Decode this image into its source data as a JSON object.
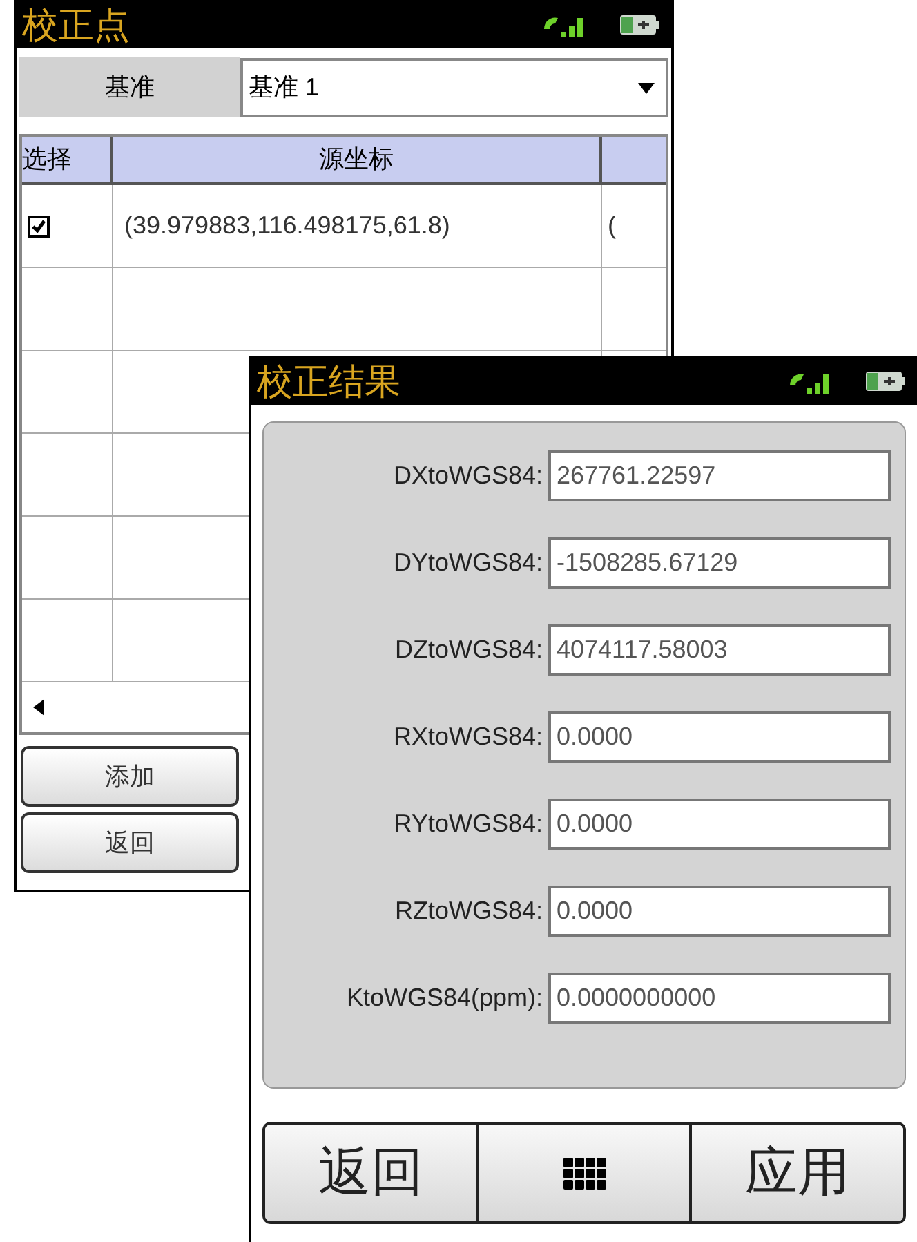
{
  "back_window": {
    "title": "校正点",
    "datum": {
      "label": "基准",
      "value": "基准 1"
    },
    "table": {
      "columns": [
        "选择",
        "源坐标"
      ],
      "rows": [
        {
          "checked": true,
          "source": "(39.979883,116.498175,61.8)",
          "column_3": "("
        }
      ]
    },
    "buttons": [
      "添加",
      "返回"
    ]
  },
  "front_window": {
    "title": "校正结果",
    "fields": [
      {
        "label": "DXtoWGS84:",
        "value": "267761.22597"
      },
      {
        "label": "DYtoWGS84:",
        "value": "-1508285.67129"
      },
      {
        "label": "DZtoWGS84:",
        "value": "4074117.58003"
      },
      {
        "label": "RXtoWGS84:",
        "value": "0.0000"
      },
      {
        "label": "RYtoWGS84:",
        "value": "0.0000"
      },
      {
        "label": "RZtoWGS84:",
        "value": "0.0000"
      },
      {
        "label": "KtoWGS84(ppm):",
        "value": "0.0000000000"
      }
    ],
    "buttons": [
      {
        "kind": "text",
        "label": "返回"
      },
      {
        "kind": "grid"
      },
      {
        "kind": "text",
        "label": "应用"
      }
    ]
  }
}
